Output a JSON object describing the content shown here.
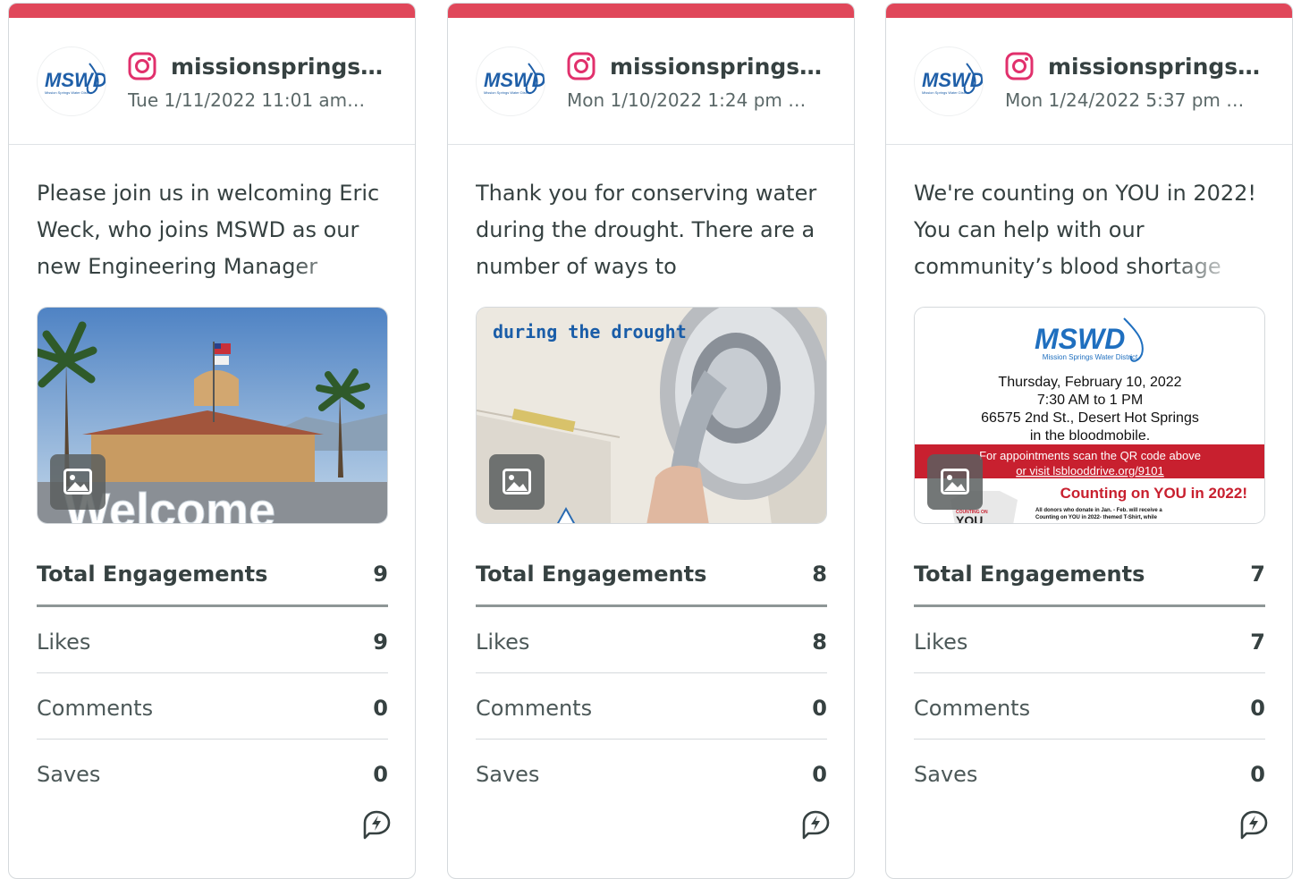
{
  "theme": {
    "accent": "#e0475a",
    "instagram": "#e1306c"
  },
  "posts": [
    {
      "network_icon": "instagram-icon",
      "avatar_text": "MSWD",
      "avatar_subtext": "Mission Springs Water District",
      "account": "missionsprings…",
      "date": "Tue 1/11/2022 11:01 am…",
      "caption": "Please join us in welcoming Eric Weck, who joins MSWD as our new Engineering Manager",
      "image_text": "Welcome",
      "stats": {
        "total_label": "Total Engagements",
        "total_value": "9",
        "likes_label": "Likes",
        "likes_value": "9",
        "comments_label": "Comments",
        "comments_value": "0",
        "saves_label": "Saves",
        "saves_value": "0"
      }
    },
    {
      "network_icon": "instagram-icon",
      "avatar_text": "MSWD",
      "avatar_subtext": "Mission Springs Water District",
      "account": "missionsprings…",
      "date": "Mon 1/10/2022 1:24 pm …",
      "caption": "Thank you for conserving water during the drought. There are a number of ways to",
      "image_text": "during the drought",
      "stats": {
        "total_label": "Total Engagements",
        "total_value": "8",
        "likes_label": "Likes",
        "likes_value": "8",
        "comments_label": "Comments",
        "comments_value": "0",
        "saves_label": "Saves",
        "saves_value": "0"
      }
    },
    {
      "network_icon": "instagram-icon",
      "avatar_text": "MSWD",
      "avatar_subtext": "Mission Springs Water District",
      "account": "missionsprings…",
      "date": "Mon 1/24/2022 5:37 pm …",
      "caption": "We're counting on YOU in 2022! You can help with our community’s blood shortage",
      "image_flyer": {
        "logo": "MSWD",
        "logo_sub": "Mission Springs Water District",
        "line1": "Thursday, February 10, 2022",
        "line2": "7:30 AM to 1 PM",
        "line3": "66575 2nd St., Desert Hot Springs",
        "line4": "in the bloodmobile.",
        "band1": "For appointments scan the QR code above",
        "band2": "or visit lsblooddrive.org/9101",
        "headline": "Counting on YOU in 2022!",
        "fine1": "All donors who donate in Jan. - Feb. will receive a",
        "fine2": "Counting on YOU in 2022- themed T-Shirt, while",
        "shirt1": "COUNTING ON",
        "shirt2": "YOU"
      },
      "stats": {
        "total_label": "Total Engagements",
        "total_value": "7",
        "likes_label": "Likes",
        "likes_value": "7",
        "comments_label": "Comments",
        "comments_value": "0",
        "saves_label": "Saves",
        "saves_value": "0"
      }
    }
  ]
}
